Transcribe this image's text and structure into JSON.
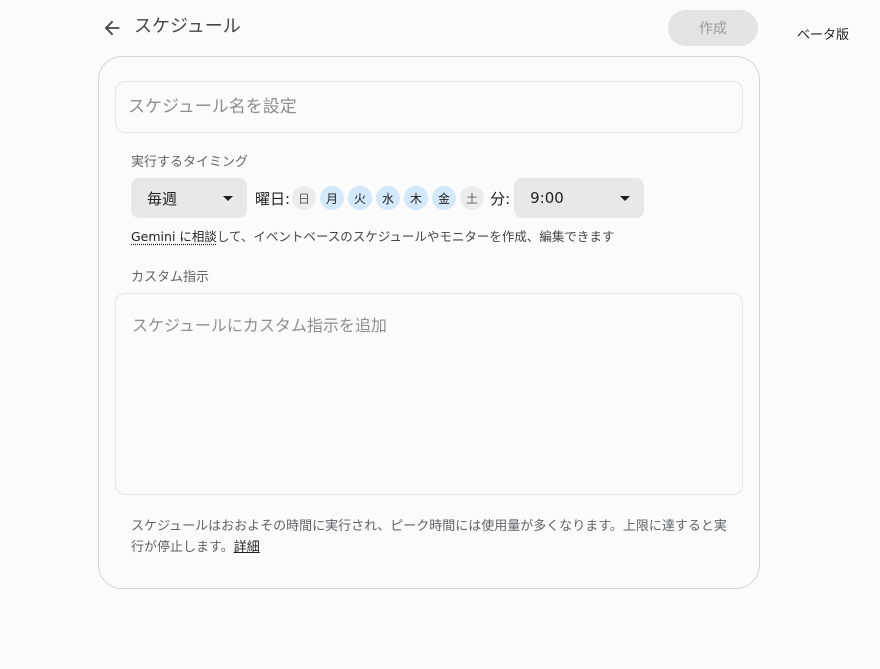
{
  "header": {
    "back_icon": "arrow-left-icon",
    "title": "スケジュール",
    "create_label": "作成",
    "beta_label": "ベータ版"
  },
  "form": {
    "name_placeholder": "スケジュール名を設定",
    "name_value": "",
    "timing": {
      "label": "実行するタイミング",
      "frequency": "毎週",
      "days_label": "曜日:",
      "days": [
        {
          "label": "日",
          "selected": false
        },
        {
          "label": "月",
          "selected": true
        },
        {
          "label": "火",
          "selected": true
        },
        {
          "label": "水",
          "selected": true
        },
        {
          "label": "木",
          "selected": true
        },
        {
          "label": "金",
          "selected": true
        },
        {
          "label": "土",
          "selected": false
        }
      ],
      "minute_label": "分:",
      "time": "9:00"
    },
    "help": {
      "link": "Gemini に相談",
      "text": "して、イベントベースのスケジュールやモニターを作成、編集できます"
    },
    "custom": {
      "label": "カスタム指示",
      "placeholder": "スケジュールにカスタム指示を追加",
      "value": ""
    },
    "footer": {
      "note": "スケジュールはおおよその時間に実行され、ピーク時間には使用量が多くなります。上限に達すると実行が停止します。",
      "link": "詳細"
    }
  },
  "colors": {
    "day_selected": "#d3e9fb",
    "day_unselected": "#ececec",
    "disabled_button": "#e3e3e3"
  }
}
